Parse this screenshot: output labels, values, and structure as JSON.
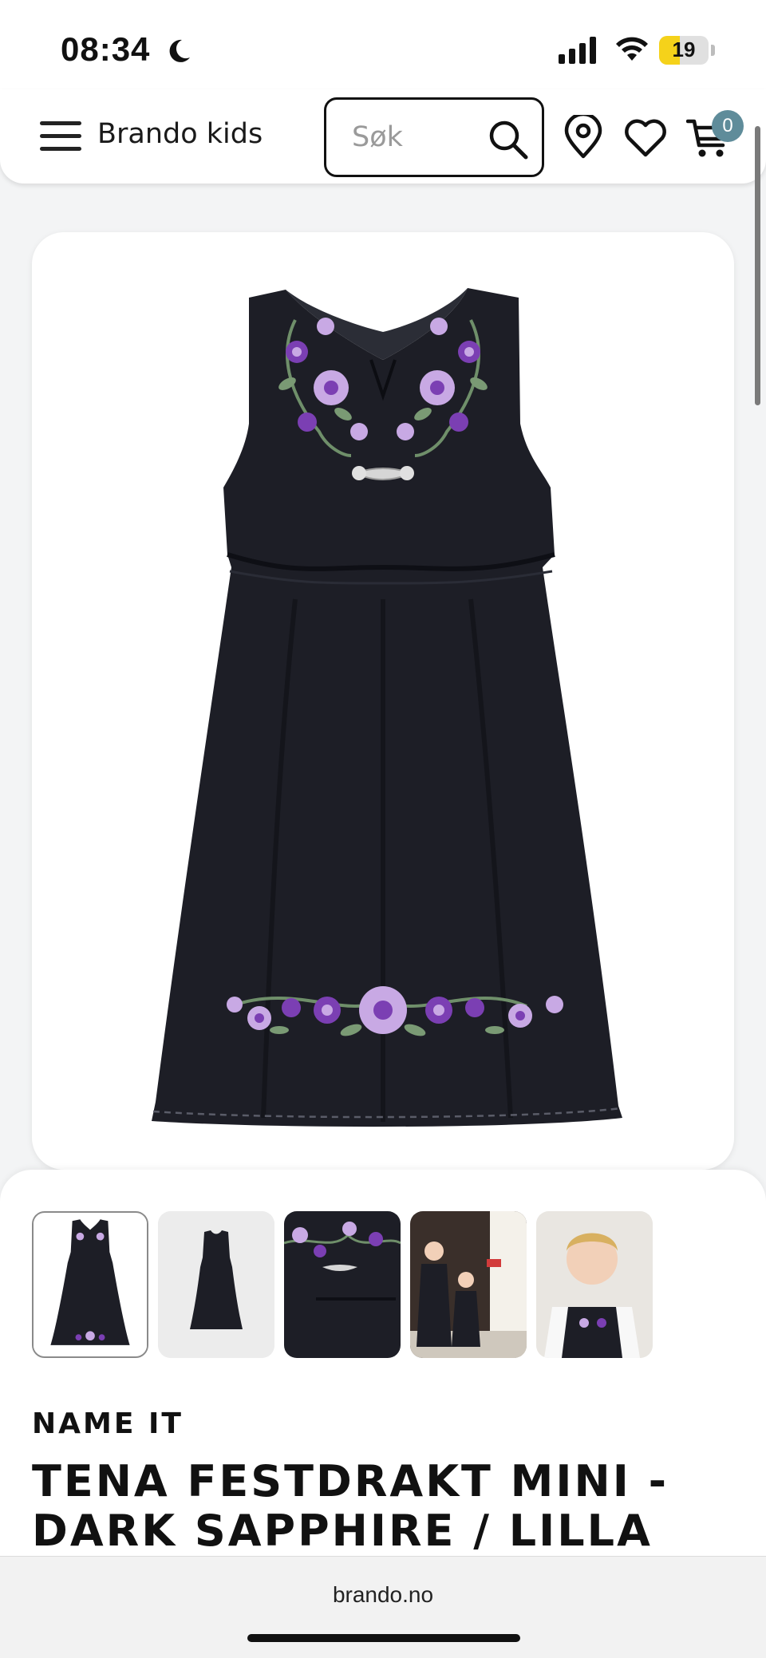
{
  "status_bar": {
    "time": "08:34",
    "battery_level": "19",
    "battery_fraction": 0.19
  },
  "header": {
    "brand_name": "Brando kids",
    "search_placeholder": "Søk",
    "cart_count": "0",
    "icons": [
      "menu-icon",
      "search-icon",
      "location-icon",
      "heart-icon",
      "cart-icon"
    ]
  },
  "product": {
    "brand": "NAME IT",
    "title": "TENA FESTDRAKT MINI - DARK SAPPHIRE / LILLA",
    "thumbnail_count": 5,
    "selected_thumbnail": 1
  },
  "browser": {
    "url": "brando.no"
  },
  "colors": {
    "dress": "#1d1e26",
    "embroidery_purple": "#7b3fb3",
    "embroidery_lilac": "#c8a9e4",
    "cart_badge": "#5f8c9a",
    "battery": "#f5d21a"
  }
}
